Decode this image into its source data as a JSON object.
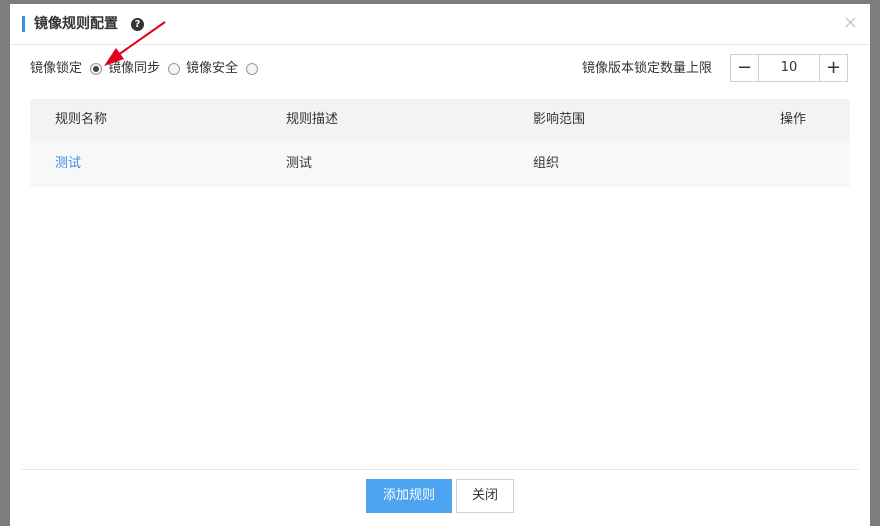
{
  "dialog": {
    "title": "镜像规则配置",
    "help_icon": "question-circle-icon",
    "close_glyph": "×"
  },
  "options": {
    "group_label": "镜像锁定",
    "items": [
      {
        "label": "镜像同步",
        "checked": true
      },
      {
        "label": "镜像安全",
        "checked": false
      },
      {
        "label": "",
        "checked": false
      }
    ]
  },
  "limit": {
    "label": "镜像版本锁定数量上限",
    "value": "10",
    "minus": "−",
    "plus": "+"
  },
  "table": {
    "headers": [
      "规则名称",
      "规则描述",
      "影响范围",
      "操作"
    ],
    "rows": [
      {
        "name": "测试",
        "description": "测试",
        "scope": "组织",
        "action": ""
      }
    ]
  },
  "footer": {
    "add_label": "添加规则",
    "close_label": "关闭"
  },
  "colors": {
    "accent": "#3a8ee6",
    "primary_button": "#4ca3f0",
    "annotation_arrow": "#e0001b"
  }
}
